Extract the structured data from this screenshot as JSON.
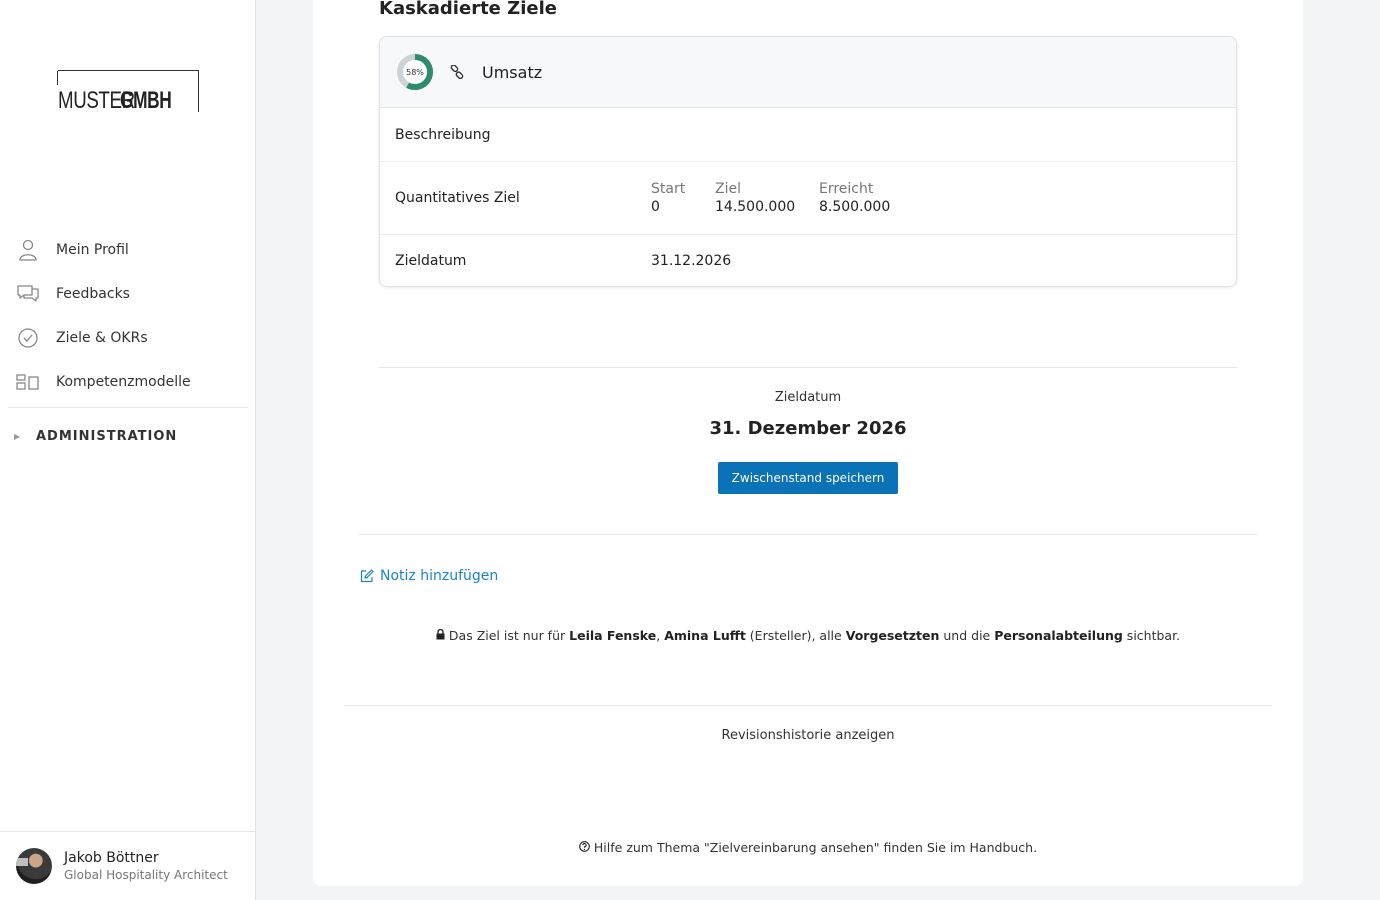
{
  "brand": {
    "logo_text_light": "MUSTER",
    "logo_text_bold": "GMBH"
  },
  "sidebar": {
    "items": [
      {
        "label": "Mein Profil",
        "icon": "user-icon"
      },
      {
        "label": "Feedbacks",
        "icon": "chat-icon"
      },
      {
        "label": "Ziele & OKRs",
        "icon": "check-circle-icon"
      },
      {
        "label": "Kompetenzmodelle",
        "icon": "grid-icon"
      }
    ],
    "admin_label": "ADMINISTRATION"
  },
  "user": {
    "name": "Jakob Böttner",
    "role": "Global Hospitality Architect"
  },
  "main": {
    "section_title": "Kaskadierte Ziele",
    "goal": {
      "progress_label": "58%",
      "progress": 0.58,
      "name": "Umsatz",
      "description_label": "Beschreibung",
      "quant_label": "Quantitatives Ziel",
      "start_head": "Start",
      "start_value": "0",
      "target_head": "Ziel",
      "target_value": "14.500.000",
      "reached_head": "Erreicht",
      "reached_value": "8.500.000",
      "date_label": "Zieldatum",
      "date_value": "31.12.2026"
    },
    "zieldatum_label": "Zieldatum",
    "zieldatum_value": "31. Dezember 2026",
    "save_button": "Zwischenstand speichern",
    "note_link": "Notiz hinzufügen",
    "visibility": {
      "prefix": "Das Ziel ist nur für ",
      "person1": "Leila Fenske",
      "comma": ", ",
      "person2": "Amina Lufft",
      "creator": " (Ersteller), alle ",
      "group1": "Vorgesetzten",
      "and": " und die ",
      "group2": "Personalabteilung",
      "suffix": " sichtbar."
    },
    "revision_link": "Revisionshistorie anzeigen",
    "help_text": "Hilfe zum Thema \"Zielvereinbarung ansehen\" finden Sie im Handbuch."
  },
  "colors": {
    "accent": "#0a73b8",
    "link": "#1a84c7",
    "progress": "#2e8b6e"
  }
}
